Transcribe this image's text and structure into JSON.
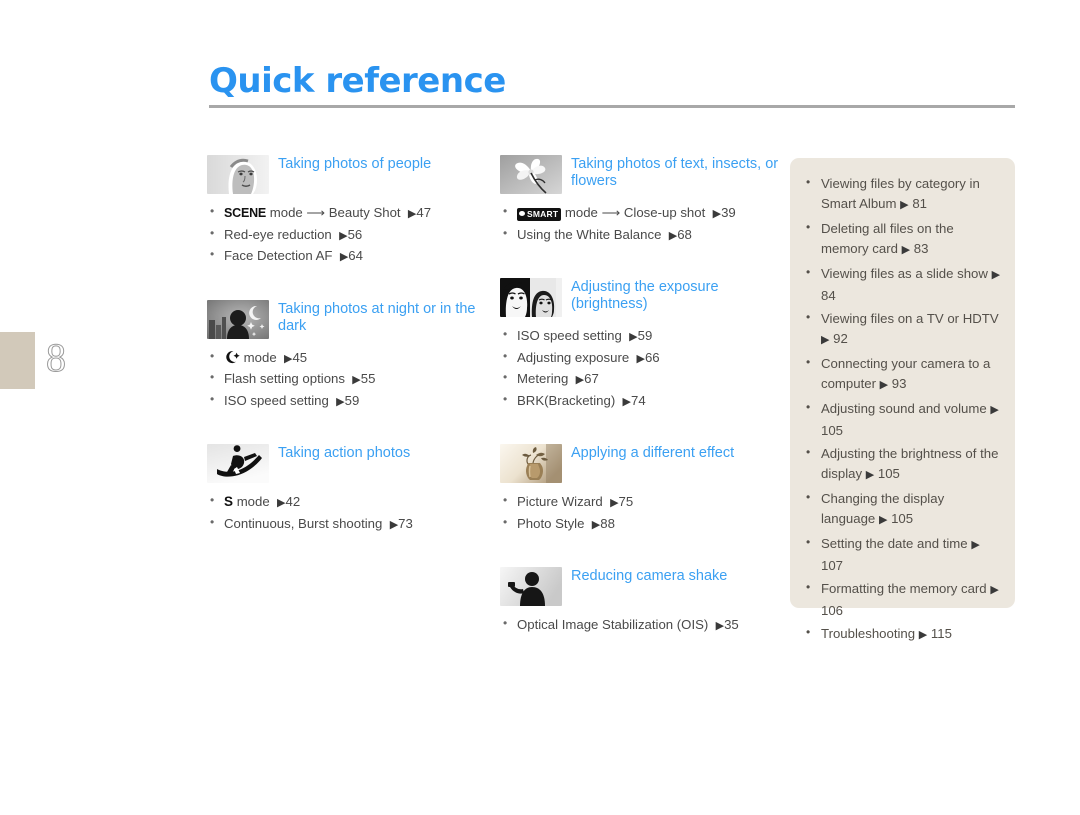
{
  "page": {
    "title": "Quick reference",
    "chapter_number": "8"
  },
  "columns": {
    "left": [
      {
        "icon": "portrait-photo-thumbnail",
        "title": "Taking photos of people",
        "items": [
          {
            "mark": "SCENE",
            "mark_type": "text-bold",
            "text": "mode",
            "arrow_to": "Beauty Shot",
            "page": "47"
          },
          {
            "text": "Red-eye reduction",
            "page": "56"
          },
          {
            "text": "Face Detection AF",
            "page": "64"
          }
        ]
      },
      {
        "icon": "night-scene-thumbnail",
        "title": "Taking photos at night or in the dark",
        "items": [
          {
            "mark": "moon-star",
            "mark_type": "glyph",
            "text": "mode",
            "page": "45"
          },
          {
            "text": "Flash setting options",
            "page": "55"
          },
          {
            "text": "ISO speed setting",
            "page": "59"
          }
        ]
      },
      {
        "icon": "snowboarder-action-thumbnail",
        "title": "Taking action photos",
        "items": [
          {
            "mark": "S",
            "mark_type": "text-bold",
            "text": "mode",
            "page": "42"
          },
          {
            "text": "Continuous, Burst shooting",
            "page": "73"
          }
        ]
      }
    ],
    "middle": [
      {
        "icon": "flower-macro-thumbnail",
        "title": "Taking photos of text, insects, or flowers",
        "items": [
          {
            "mark": "SMART",
            "mark_type": "badge",
            "text": "mode",
            "arrow_to": "Close-up shot",
            "page": "39"
          },
          {
            "text": "Using the White Balance",
            "page": "68"
          }
        ]
      },
      {
        "icon": "two-faces-exposure-thumbnail",
        "title": "Adjusting the exposure (brightness)",
        "items": [
          {
            "text": "ISO speed setting",
            "page": "59"
          },
          {
            "text": "Adjusting exposure",
            "page": "66"
          },
          {
            "text": "Metering",
            "page": "67"
          },
          {
            "text": "BRK(Bracketing)",
            "page": "74"
          }
        ]
      },
      {
        "icon": "sepia-vase-effect-thumbnail",
        "title": "Applying a different effect",
        "items": [
          {
            "text": "Picture Wizard",
            "page": "75"
          },
          {
            "text": "Photo Style",
            "page": "88"
          }
        ]
      },
      {
        "icon": "camera-shake-silhouette-thumbnail",
        "title": "Reducing camera shake",
        "items": [
          {
            "text": "Optical Image Stabilization (OIS)",
            "page": "35"
          }
        ]
      }
    ]
  },
  "side_box": {
    "items": [
      {
        "text": "Viewing files by category in Smart Album",
        "page": "81"
      },
      {
        "text": "Deleting all files on the memory card",
        "page": "83"
      },
      {
        "text": "Viewing files as a slide show",
        "page": "84"
      },
      {
        "text": "Viewing files on a TV or HDTV",
        "page": "92"
      },
      {
        "text": "Connecting your camera to a computer",
        "page": "93"
      },
      {
        "text": "Adjusting sound and volume",
        "page": "105"
      },
      {
        "text": "Adjusting the brightness of the display",
        "page": "105"
      },
      {
        "text": "Changing the display language",
        "page": "105"
      },
      {
        "text": "Setting the date and time",
        "page": "107"
      },
      {
        "text": "Formatting the memory card",
        "page": "106"
      },
      {
        "text": "Troubleshooting",
        "page": "115"
      }
    ]
  },
  "colors": {
    "accent_blue": "#3ba0f2",
    "title_blue": "#2a93f0",
    "tab_beige": "#d2c9ba",
    "box_beige": "#ece7de",
    "body_text": "#4a4a4a"
  }
}
